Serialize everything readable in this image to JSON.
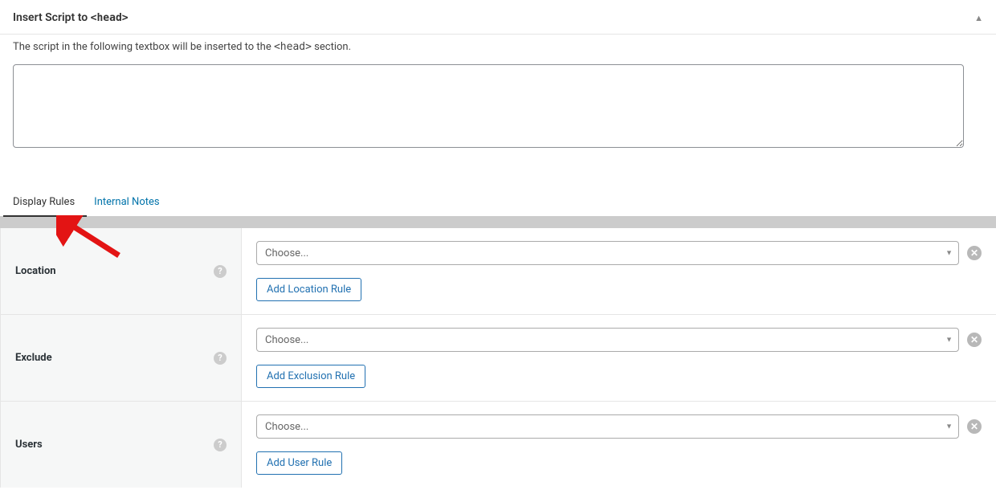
{
  "panel": {
    "title_prefix": "Insert Script to ",
    "title_tag": "<head>",
    "desc_prefix": "The script in the following textbox will be inserted to the ",
    "desc_tag": "<head>",
    "desc_suffix": " section.",
    "textarea_value": ""
  },
  "tabs": {
    "display_rules": "Display Rules",
    "internal_notes": "Internal Notes"
  },
  "rules": {
    "location": {
      "label": "Location",
      "select_placeholder": "Choose...",
      "add_button": "Add Location Rule"
    },
    "exclude": {
      "label": "Exclude",
      "select_placeholder": "Choose...",
      "add_button": "Add Exclusion Rule"
    },
    "users": {
      "label": "Users",
      "select_placeholder": "Choose...",
      "add_button": "Add User Rule"
    }
  },
  "help_glyph": "?"
}
